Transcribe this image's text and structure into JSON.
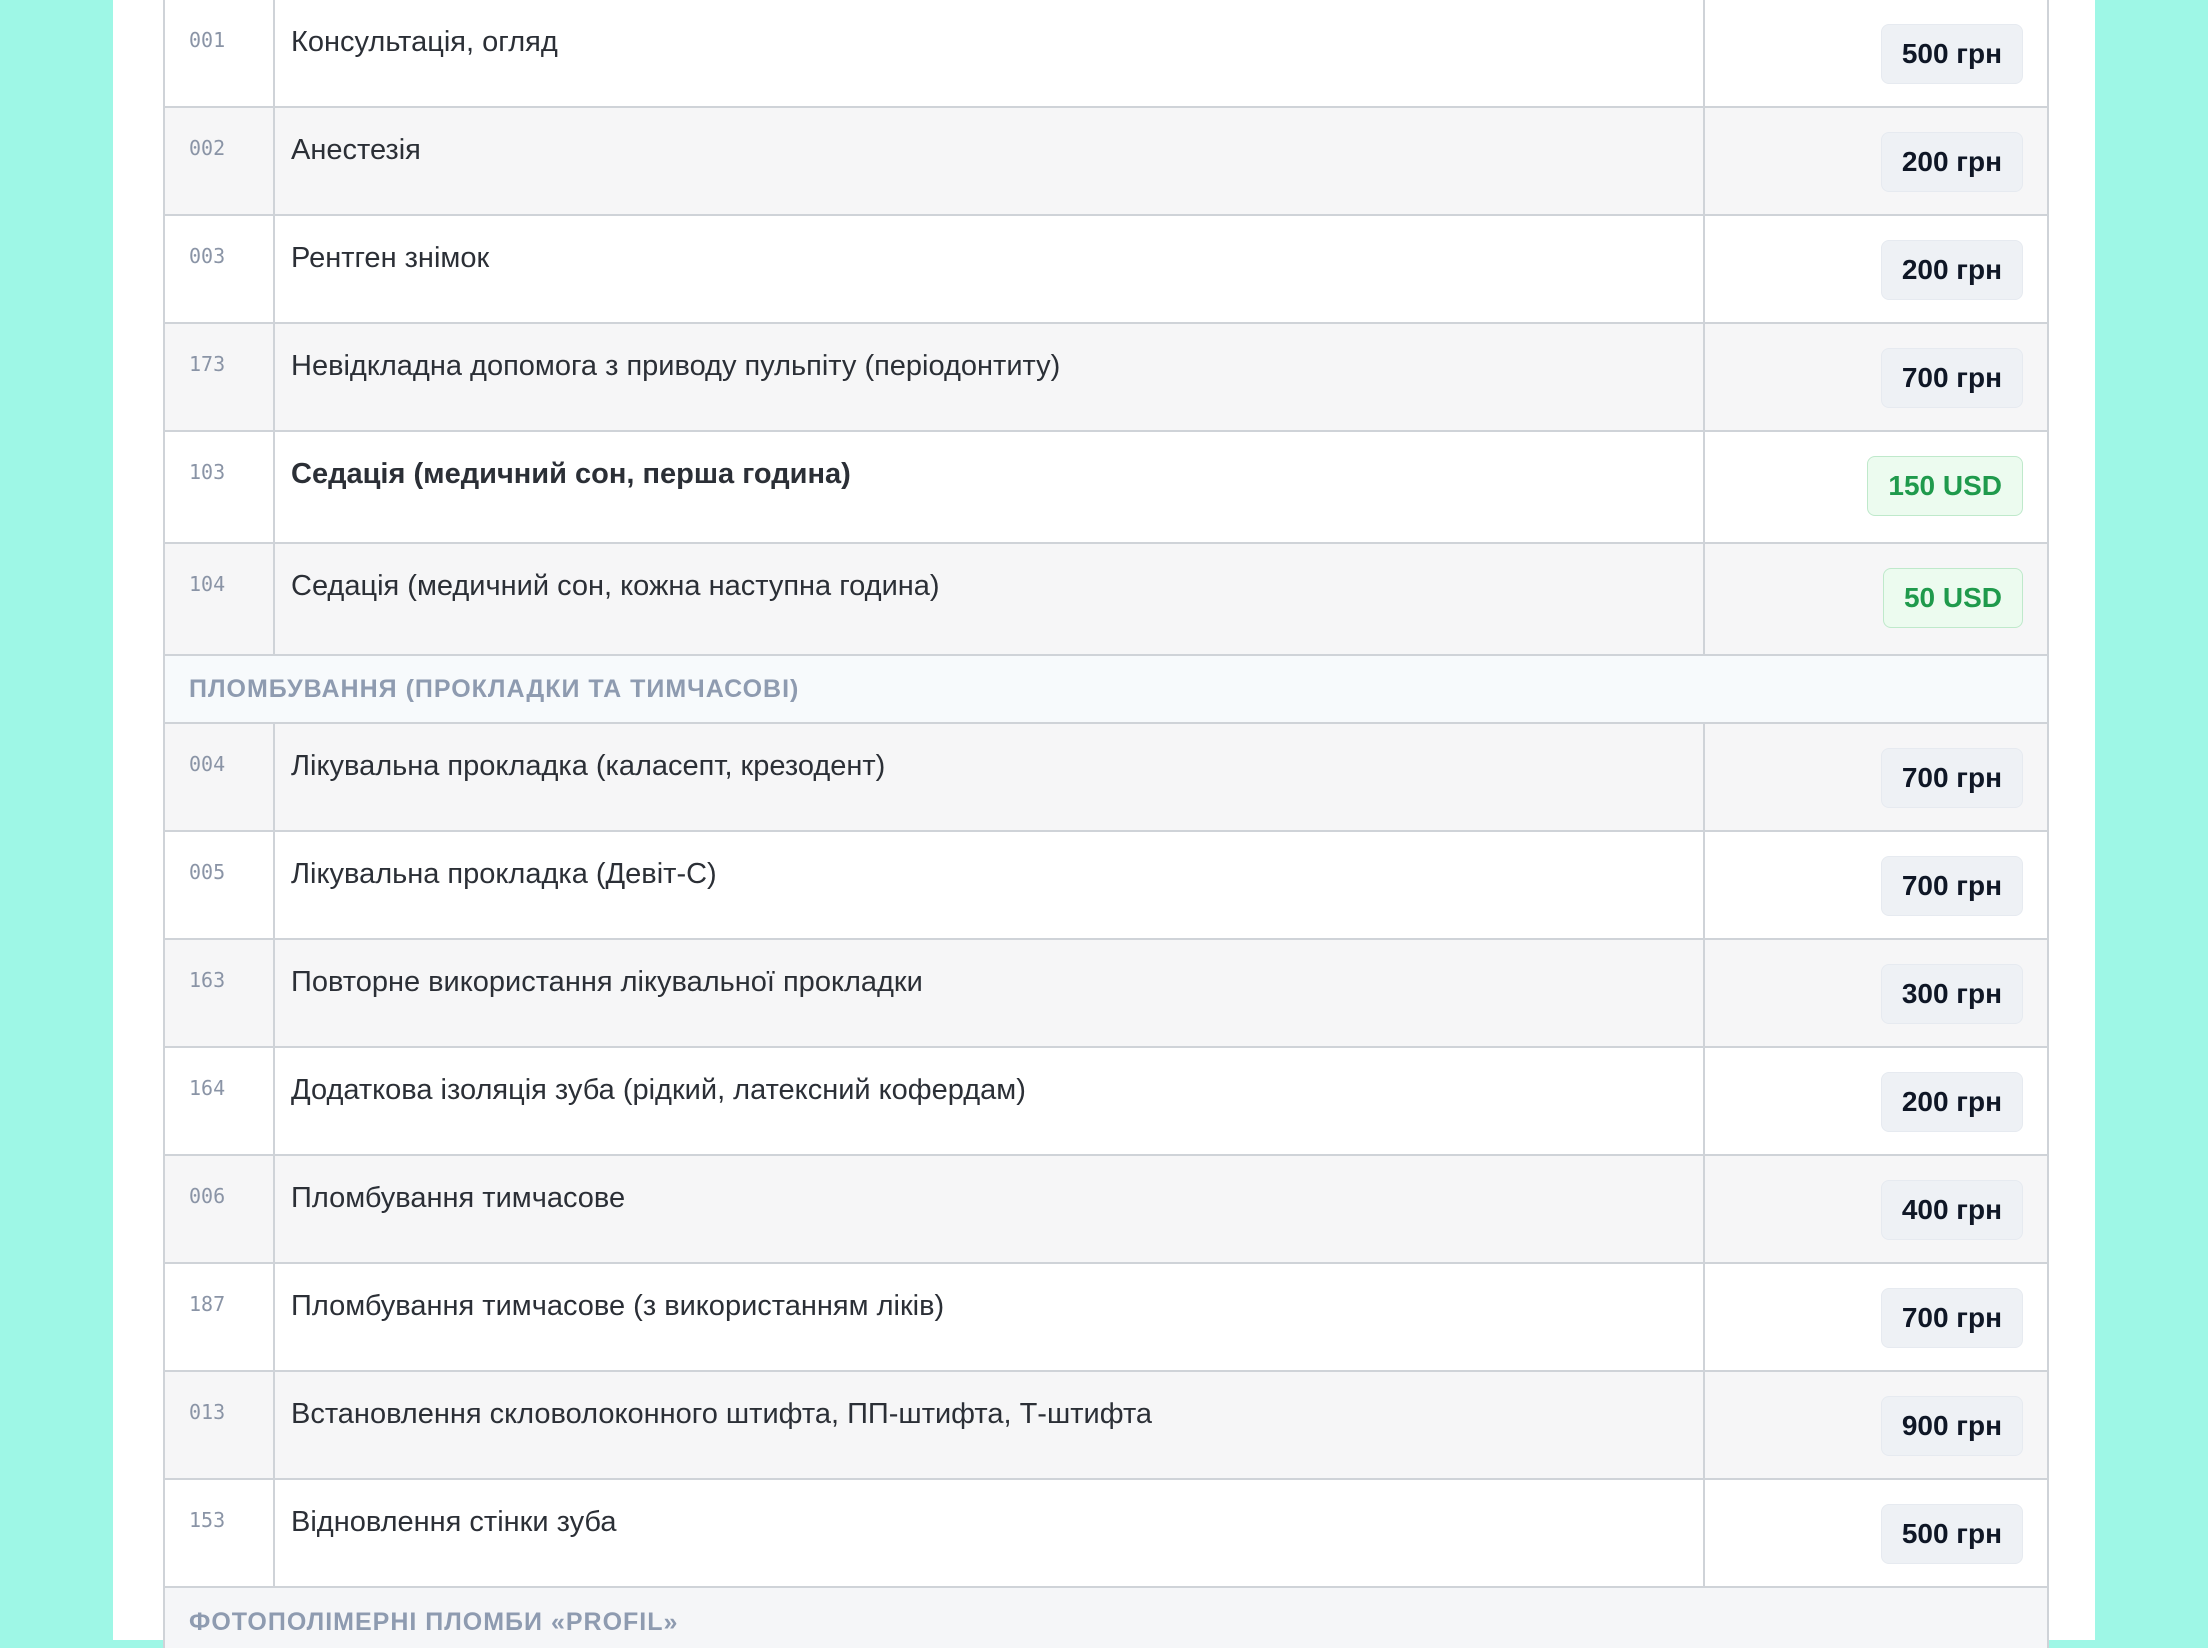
{
  "services": {
    "rows_top": [
      {
        "code": "001",
        "name": "Консультація, огляд",
        "price": "500 грн",
        "currency_type": "uah"
      },
      {
        "code": "002",
        "name": "Анестезія",
        "price": "200 грн",
        "currency_type": "uah"
      },
      {
        "code": "003",
        "name": "Рентген знімок",
        "price": "200 грн",
        "currency_type": "uah"
      },
      {
        "code": "173",
        "name": "Невідкладна допомога з приводу пульпіту (періодонтиту)",
        "price": "700 грн",
        "currency_type": "uah"
      },
      {
        "code": "103",
        "name": "Седація (медичний сон, перша година)",
        "price": "150 USD",
        "currency_type": "usd",
        "bold": true
      },
      {
        "code": "104",
        "name": "Седація (медичний сон, кожна наступна година)",
        "price": "50 USD",
        "currency_type": "usd"
      }
    ],
    "section_fillings": "ПЛОМБУВАННЯ (ПРОКЛАДКИ ТА ТИМЧАСОВІ)",
    "rows_fillings": [
      {
        "code": "004",
        "name": "Лікувальна прокладка (каласепт, крезодент)",
        "price": "700 грн",
        "currency_type": "uah"
      },
      {
        "code": "005",
        "name": "Лікувальна прокладка (Девіт-С)",
        "price": "700 грн",
        "currency_type": "uah"
      },
      {
        "code": "163",
        "name": "Повторне використання лікувальної прокладки",
        "price": "300 грн",
        "currency_type": "uah"
      },
      {
        "code": "164",
        "name": "Додаткова ізоляція зуба (рідкий, латексний кофердам)",
        "price": "200 грн",
        "currency_type": "uah"
      },
      {
        "code": "006",
        "name": "Пломбування тимчасове",
        "price": "400 грн",
        "currency_type": "uah"
      },
      {
        "code": "187",
        "name": "Пломбування тимчасове (з використанням ліків)",
        "price": "700 грн",
        "currency_type": "uah"
      },
      {
        "code": "013",
        "name": "Встановлення скловолоконного штифта, ПП-штифта, Т-штифта",
        "price": "900 грн",
        "currency_type": "uah"
      },
      {
        "code": "153",
        "name": "Відновлення стінки зуба",
        "price": "500 грн",
        "currency_type": "uah"
      }
    ],
    "section_photopolymer": "ФОТОПОЛІМЕРНІ ПЛОМБИ «PROFIL»"
  },
  "colors": {
    "page_background": "#9ef7e6",
    "usd_accent": "#1f9a4c",
    "section_text": "#8e9bb0"
  }
}
